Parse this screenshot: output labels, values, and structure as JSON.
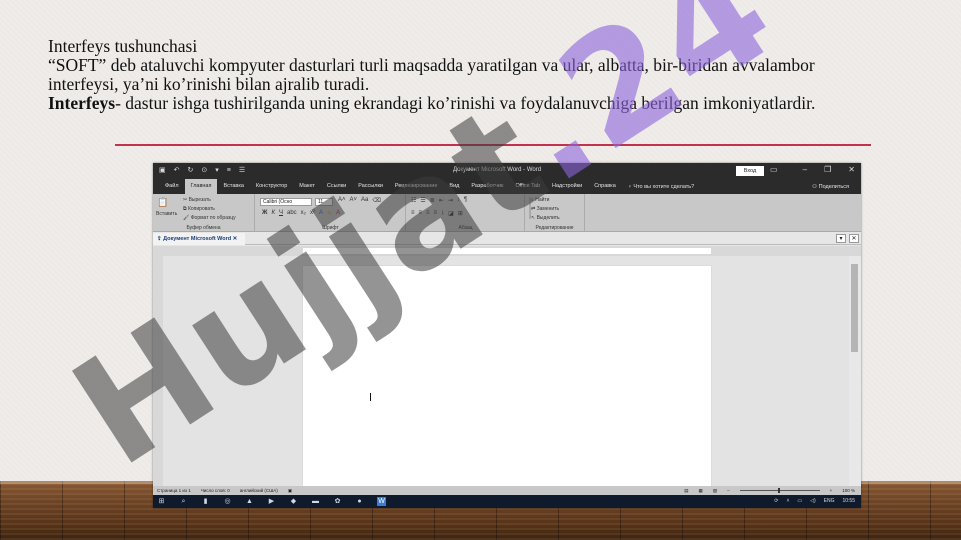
{
  "slide": {
    "heading": "Interfeys tushunchasi",
    "paragraph1": "“SOFT” deb ataluvchi kompyuter dasturlari turli maqsadda yaratilgan va ular, albatta, bir-biridan avvalambor interfeysi, ya’ni ko’rinishi bilan ajralib turadi.",
    "term": "Interfeys",
    "definition": "- dastur ishga tushirilganda uning ekrandagi ko’rinishi va foydalanuvchiga berilgan imkoniyatlardir."
  },
  "watermark": {
    "text": "Hujjat.24"
  },
  "word": {
    "title": "Документ Microsoft Word  -  Word",
    "signin": "Вход",
    "tabs": [
      "Файл",
      "Главная",
      "Вставка",
      "Конструктор",
      "Макет",
      "Ссылки",
      "Рассылки",
      "Рецензирование",
      "Вид",
      "Разработчик",
      "Office Tab",
      "Надстройки",
      "Справка"
    ],
    "active_tab": "Главная",
    "tell_me": "Что вы хотите сделать?",
    "share": "Поделиться",
    "ribbon": {
      "paste": "Вставить",
      "cut": "Вырезать",
      "copy": "Копировать",
      "format_painter": "Формат по образцу",
      "clipboard_group": "Буфер обмена",
      "font_name": "Calibri (Осно",
      "font_size": "11",
      "font_group": "Шрифт",
      "paragraph_group": "Абзац",
      "find": "Найти",
      "replace": "Заменить",
      "select": "Выделить",
      "editing_group": "Редактирование"
    },
    "doc_tab": "Документ Microsoft Word",
    "status": {
      "page": "Страница 1 из 1",
      "words": "Число слов: 0",
      "language": "английский (США)",
      "zoom": "100 %"
    },
    "taskbar": {
      "lang": "ENG",
      "time": "10:55"
    }
  }
}
